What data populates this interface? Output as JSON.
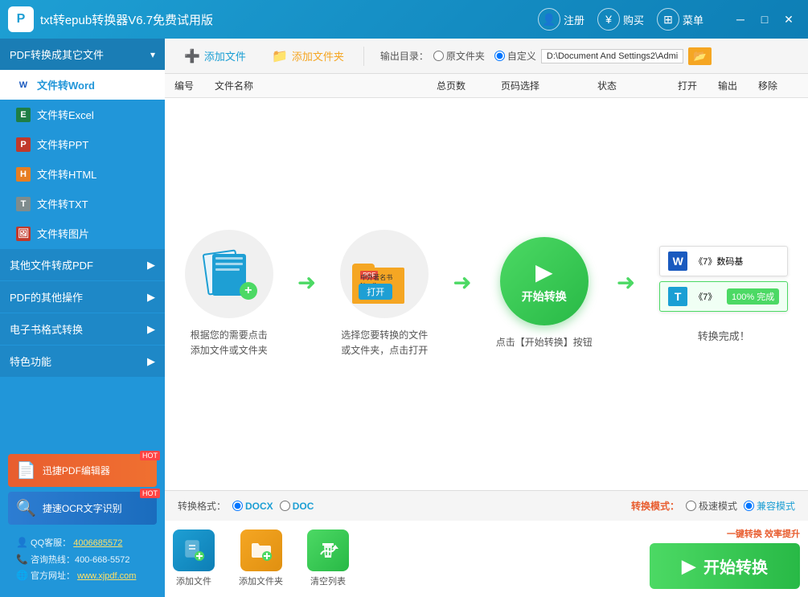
{
  "titlebar": {
    "title": "txt转epub转换器V6.7免费试用版",
    "logo_letter": "P",
    "register_label": "注册",
    "buy_label": "购买",
    "menu_label": "菜单"
  },
  "sidebar": {
    "pdf_convert_header": "PDF转换成其它文件",
    "menu_items": [
      {
        "id": "word",
        "label": "文件转Word",
        "active": true,
        "icon": "W"
      },
      {
        "id": "excel",
        "label": "文件转Excel",
        "active": false,
        "icon": "E"
      },
      {
        "id": "ppt",
        "label": "文件转PPT",
        "active": false,
        "icon": "P"
      },
      {
        "id": "html",
        "label": "文件转HTML",
        "active": false,
        "icon": "H"
      },
      {
        "id": "txt",
        "label": "文件转TXT",
        "active": false,
        "icon": "T"
      },
      {
        "id": "image",
        "label": "文件转图片",
        "active": false,
        "icon": "I"
      }
    ],
    "other_to_pdf": "其他文件转成PDF",
    "pdf_operations": "PDF的其他操作",
    "ebook_convert": "电子书格式转换",
    "special_features": "特色功能",
    "promo_pdf_label": "迅捷PDF编辑器",
    "promo_ocr_label": "捷速OCR文字识别",
    "hot_badge": "HOT",
    "qq_label": "QQ客服：",
    "qq_number": "4006685572",
    "consult_label": "咨询热线：400-668-5572",
    "website_label": "官方网址：",
    "website_url": "www.xjpdf.com"
  },
  "toolbar": {
    "add_file_label": "添加文件",
    "add_folder_label": "添加文件夹",
    "output_dir_label": "输出目录：",
    "original_folder_label": "原文件夹",
    "custom_label": "自定义",
    "output_path": "D:\\Document And Settings2\\Admi"
  },
  "table_headers": {
    "num": "编号",
    "name": "文件名称",
    "pages": "总页数",
    "pagecode": "页码选择",
    "status": "状态",
    "open": "打开",
    "output": "输出",
    "remove": "移除"
  },
  "illustration": {
    "step1_text": "根据您的需要点击\n添加文件或文件夹",
    "step2_text": "选择您要转换的文件\n或文件夹，点击打开",
    "open_btn_label": "打开",
    "step3_text": "点击【开始转换】按钮",
    "step4_text": "转换完成！",
    "start_convert_label": "开始转换",
    "preview1_title": "《7》数码基",
    "preview2_title": "《7》",
    "preview2_done": "100%  完成"
  },
  "bottom_bar": {
    "format_label": "转换格式：",
    "docx_label": "DOCX",
    "doc_label": "DOC",
    "mode_label": "转换模式：",
    "fast_mode_label": "极速模式",
    "compat_mode_label": "兼容模式"
  },
  "bottom_actions": {
    "add_file_label": "添加文件",
    "add_folder_label": "添加文件夹",
    "clear_list_label": "清空列表",
    "efficiency_text": "一键转换 效率提升",
    "start_convert_label": "开始转换"
  }
}
